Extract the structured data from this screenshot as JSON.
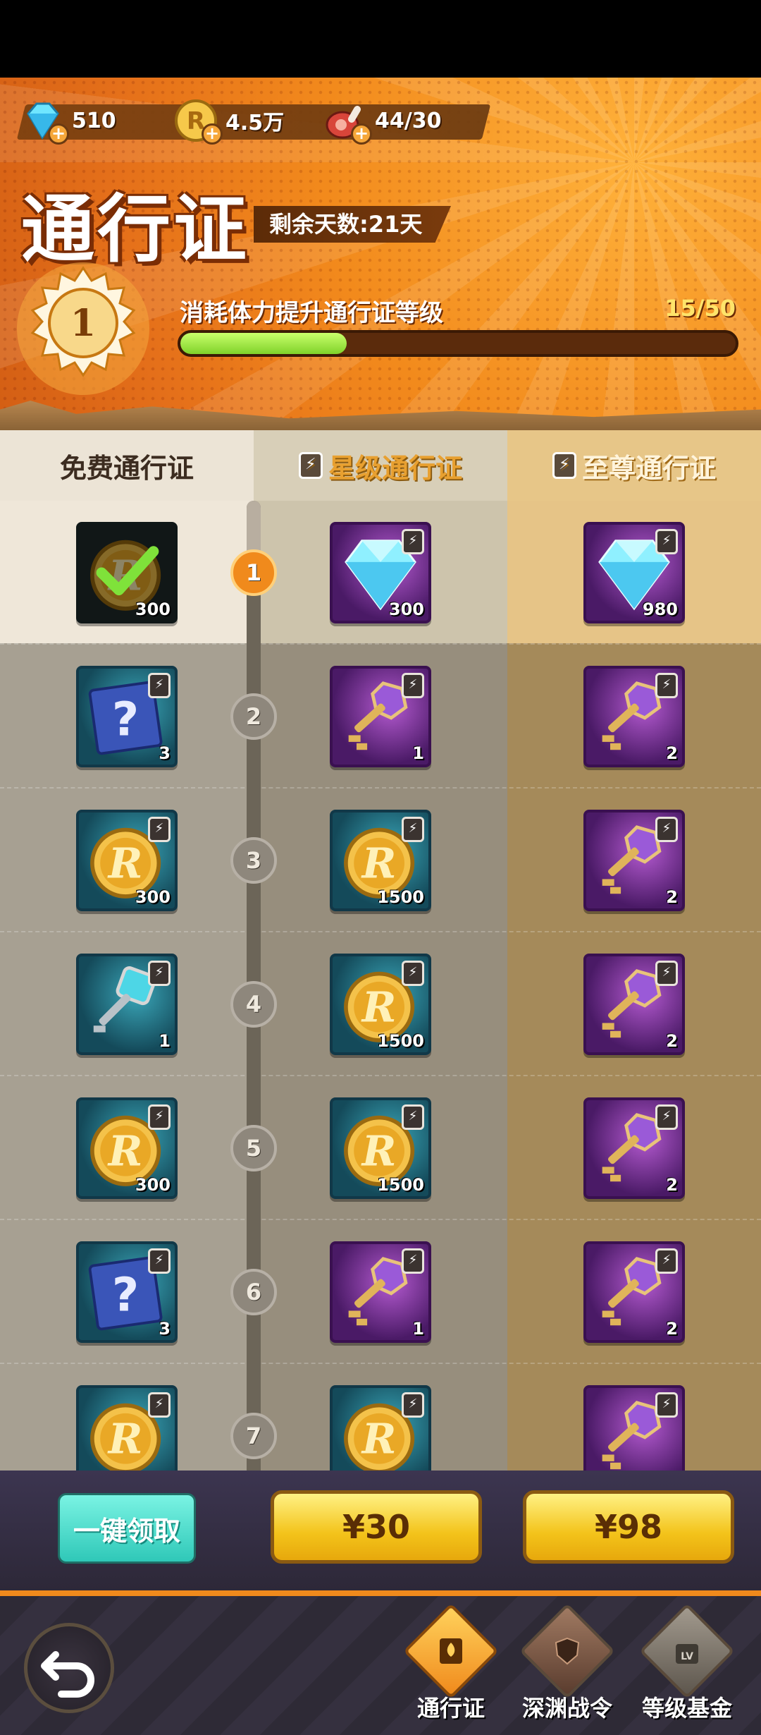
{
  "resources": [
    {
      "icon": "diamond-icon",
      "value": "510"
    },
    {
      "icon": "coin-icon",
      "value": "4.5万"
    },
    {
      "icon": "meat-icon",
      "value": "44/30"
    }
  ],
  "header": {
    "title": "通行证",
    "remaining_days": "剩余天数:21天",
    "level": "1",
    "level_label": "消耗体力提升通行证等级",
    "progress_text": "15/50",
    "progress_fraction": 0.3
  },
  "columns": [
    "免费通行证",
    "星级通行证",
    "至尊通行证"
  ],
  "rows": [
    {
      "level": "1",
      "free": {
        "kind": "coin",
        "qty": "300",
        "claimed": true
      },
      "star": {
        "kind": "diamond",
        "qty": "300"
      },
      "supreme": {
        "kind": "diamond",
        "qty": "980"
      }
    },
    {
      "level": "2",
      "free": {
        "kind": "mystery",
        "qty": "3"
      },
      "star": {
        "kind": "purple-key",
        "qty": "1"
      },
      "supreme": {
        "kind": "purple-key",
        "qty": "2"
      }
    },
    {
      "level": "3",
      "free": {
        "kind": "coin",
        "qty": "300"
      },
      "star": {
        "kind": "coin",
        "qty": "1500"
      },
      "supreme": {
        "kind": "purple-key",
        "qty": "2"
      }
    },
    {
      "level": "4",
      "free": {
        "kind": "blue-key",
        "qty": "1"
      },
      "star": {
        "kind": "coin",
        "qty": "1500"
      },
      "supreme": {
        "kind": "purple-key",
        "qty": "2"
      }
    },
    {
      "level": "5",
      "free": {
        "kind": "coin",
        "qty": "300"
      },
      "star": {
        "kind": "coin",
        "qty": "1500"
      },
      "supreme": {
        "kind": "purple-key",
        "qty": "2"
      }
    },
    {
      "level": "6",
      "free": {
        "kind": "mystery",
        "qty": "3"
      },
      "star": {
        "kind": "purple-key",
        "qty": "1"
      },
      "supreme": {
        "kind": "purple-key",
        "qty": "2"
      }
    },
    {
      "level": "7",
      "free": {
        "kind": "coin",
        "qty": ""
      },
      "star": {
        "kind": "coin",
        "qty": ""
      },
      "supreme": {
        "kind": "purple-key",
        "qty": ""
      }
    }
  ],
  "actions": {
    "claim_all": "一键领取",
    "price_star": "¥30",
    "price_supreme": "¥98"
  },
  "nav": {
    "tabs": [
      {
        "label": "通行证",
        "icon": "pass-icon",
        "active": true
      },
      {
        "label": "深渊战令",
        "icon": "abyss-shield-icon",
        "active": false
      },
      {
        "label": "等级基金",
        "icon": "level-fund-icon",
        "active": false
      }
    ],
    "back_icon": "back-arrow-icon"
  },
  "colors": {
    "accent_orange": "#f08a1c",
    "progress_green": "#7fd22a",
    "claim_teal": "#2fc8b8",
    "price_yellow": "#f3c31a"
  }
}
